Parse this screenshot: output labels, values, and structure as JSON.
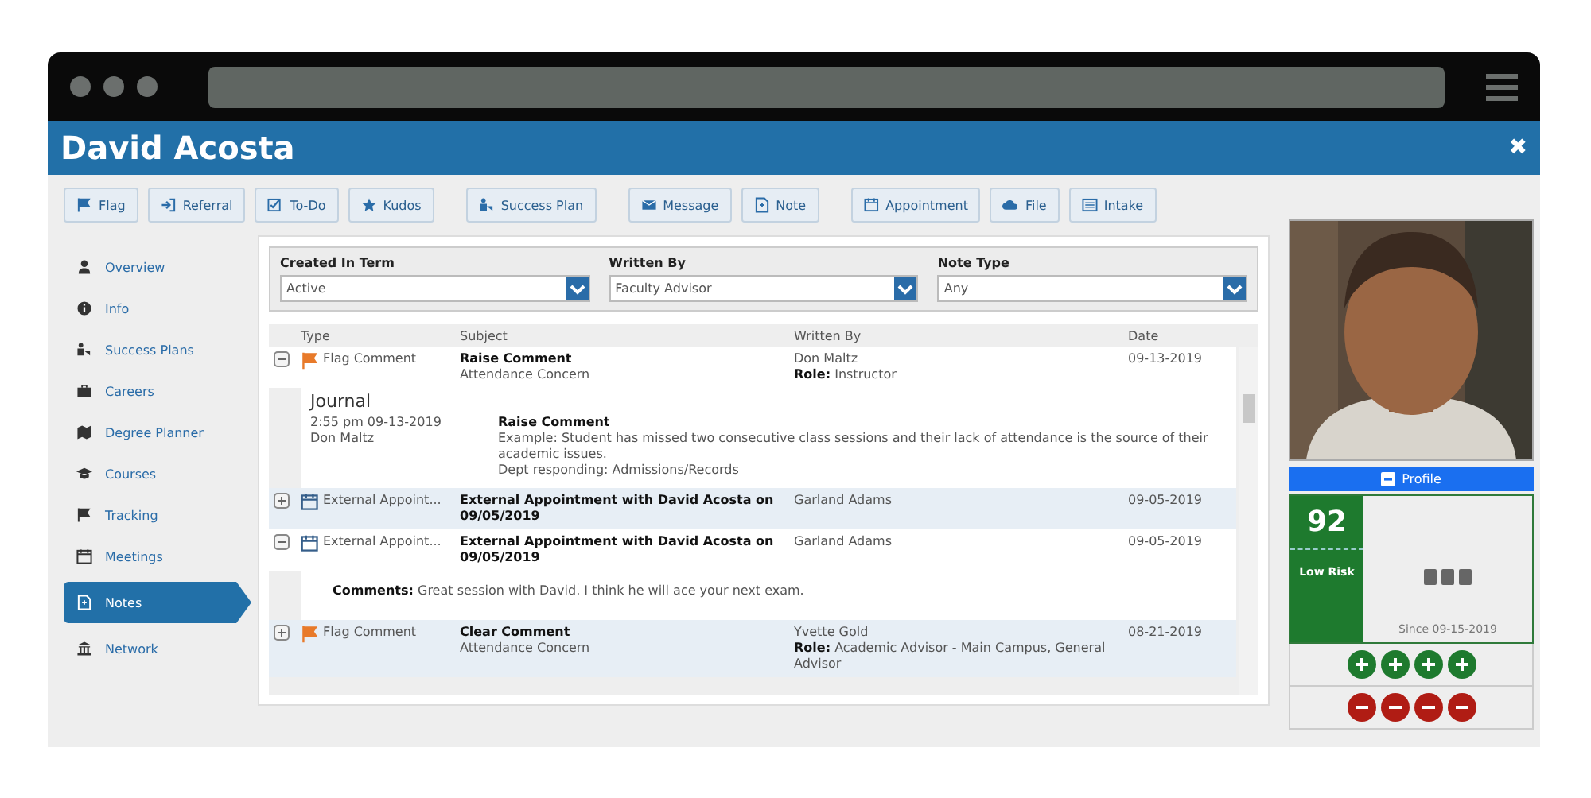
{
  "window": {
    "title": "David Acosta",
    "close": "✖"
  },
  "toolbar": {
    "groups": [
      [
        {
          "label": "Flag"
        },
        {
          "label": "Referral"
        },
        {
          "label": "To-Do"
        },
        {
          "label": "Kudos"
        }
      ],
      [
        {
          "label": "Success Plan"
        }
      ],
      [
        {
          "label": "Message"
        },
        {
          "label": "Note"
        }
      ],
      [
        {
          "label": "Appointment"
        },
        {
          "label": "File"
        },
        {
          "label": "Intake"
        }
      ]
    ]
  },
  "sidebar": {
    "items": [
      {
        "label": "Overview",
        "selected": false
      },
      {
        "label": "Info",
        "selected": false
      },
      {
        "label": "Success Plans",
        "selected": false
      },
      {
        "label": "Careers",
        "selected": false
      },
      {
        "label": "Degree Planner",
        "selected": false
      },
      {
        "label": "Courses",
        "selected": false
      },
      {
        "label": "Tracking",
        "selected": false
      },
      {
        "label": "Meetings",
        "selected": false
      },
      {
        "label": "Notes",
        "selected": true
      },
      {
        "label": "Network",
        "selected": false
      }
    ]
  },
  "filters": [
    {
      "label": "Created In Term",
      "value": "Active"
    },
    {
      "label": "Written By",
      "value": "Faculty Advisor"
    },
    {
      "label": "Note Type",
      "value": "Any"
    }
  ],
  "table": {
    "columns": [
      "Type",
      "Subject",
      "Written By",
      "Date"
    ],
    "rows": [
      {
        "expanded": true,
        "kind": "flag",
        "type": "Flag Comment",
        "subject": "Raise Comment",
        "subject_detail": "Attendance Concern",
        "writer": "Don Maltz",
        "role_label": "Role:",
        "role": "Instructor",
        "date": "09-13-2019",
        "journal": {
          "heading": "Journal",
          "time": "2:55 pm 09-13-2019",
          "author": "Don Maltz",
          "title": "Raise Comment",
          "lines": [
            "Example: Student has missed two consecutive class sessions and their lack of attendance is the source of their academic issues.",
            "Dept responding: Admissions/Records"
          ]
        }
      },
      {
        "expanded": false,
        "kind": "appointment",
        "type": "External Appoint...",
        "subject": "External Appointment with David Acosta on 09/05/2019",
        "writer": "Garland Adams",
        "date": "09-05-2019"
      },
      {
        "expanded": true,
        "kind": "appointment",
        "type": "External Appoint...",
        "subject": "External Appointment with David Acosta on 09/05/2019",
        "writer": "Garland Adams",
        "date": "09-05-2019",
        "comment": "**Comments:** Great session with David. I think he will ace your next exam."
      },
      {
        "expanded": false,
        "kind": "flag",
        "type": "Flag Comment",
        "subject": "Clear Comment",
        "subject_detail": "Attendance Concern",
        "writer": "Yvette Gold",
        "role_label": "Role:",
        "role": "Academic Advisor - Main Campus, General Advisor",
        "date": "08-21-2019"
      }
    ]
  },
  "profile": {
    "button": "Profile",
    "score": "92",
    "risk": "Low Risk",
    "since": "Since 09-15-2019"
  }
}
